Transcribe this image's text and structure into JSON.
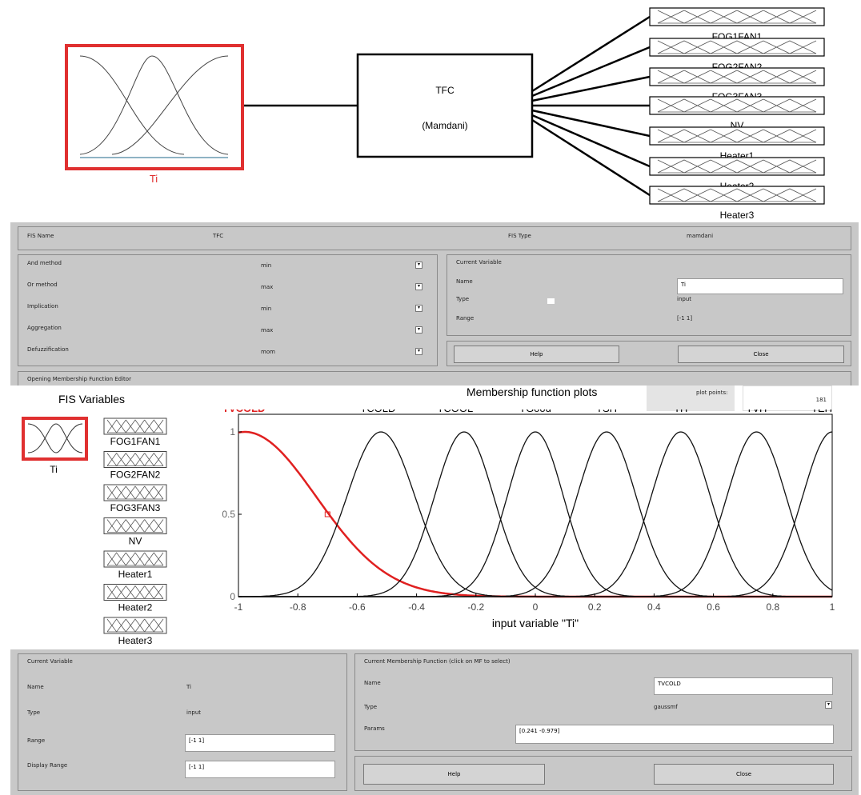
{
  "diagram": {
    "input_name": "Ti",
    "system_name": "TFC",
    "system_type": "(Mamdani)",
    "outputs": [
      "FOG1FAN1",
      "FOG2FAN2",
      "FOG3FAN3",
      "NV",
      "Heater1",
      "Heater2",
      "Heater3"
    ]
  },
  "fis_editor": {
    "fis_name_label": "FIS Name",
    "fis_name_value": "TFC",
    "fis_type_label": "FIS Type",
    "fis_type_value": "mamdani",
    "methods": [
      {
        "label": "And method",
        "value": "min"
      },
      {
        "label": "Or method",
        "value": "max"
      },
      {
        "label": "Implication",
        "value": "min"
      },
      {
        "label": "Aggregation",
        "value": "max"
      },
      {
        "label": "Defuzzification",
        "value": "mom"
      }
    ],
    "current_variable": {
      "title": "Current Variable",
      "name_label": "Name",
      "name_value": "Ti",
      "type_label": "Type",
      "type_value": "input",
      "range_label": "Range",
      "range_value": "[-1 1]"
    },
    "help_label": "Help",
    "close_label": "Close",
    "status": "Opening Membership Function Editor"
  },
  "mf_editor": {
    "fis_variables_title": "FIS Variables",
    "input_var": "Ti",
    "output_vars": [
      "FOG1FAN1",
      "FOG2FAN2",
      "FOG3FAN3",
      "NV",
      "Heater1",
      "Heater2",
      "Heater3"
    ],
    "plot_title": "Membership function plots",
    "plot_points_label": "plot points:",
    "plot_points_value": "181",
    "mf_names": [
      "TVCOLD",
      "TCOLD",
      "TCOOL",
      "TGood",
      "TSH",
      "TH",
      "TVH",
      "TEH"
    ],
    "x_label": "input variable \"Ti\"",
    "x_ticks": [
      "-1",
      "-0.8",
      "-0.6",
      "-0.4",
      "-0.2",
      "0",
      "0.2",
      "0.4",
      "0.6",
      "0.8",
      "1"
    ],
    "y_ticks": [
      "0",
      "0.5",
      "1"
    ],
    "current_variable": {
      "title": "Current Variable",
      "name_label": "Name",
      "name_value": "Ti",
      "type_label": "Type",
      "type_value": "input",
      "range_label": "Range",
      "range_value": "[-1 1]",
      "display_range_label": "Display Range",
      "display_range_value": "[-1 1]"
    },
    "current_mf": {
      "title": "Current Membership Function (click on MF to select)",
      "name_label": "Name",
      "name_value": "TVCOLD",
      "type_label": "Type",
      "type_value": "gaussmf",
      "params_label": "Params",
      "params_value": "[0.241 -0.979]"
    },
    "help_label": "Help",
    "close_label": "Close"
  },
  "chart_data": {
    "type": "line",
    "title": "Membership function plots",
    "xlabel": "input variable \"Ti\"",
    "ylabel": "",
    "xlim": [
      -1,
      1
    ],
    "ylim": [
      0,
      1
    ],
    "series": [
      {
        "name": "TVCOLD",
        "center": -0.979,
        "sigma": 0.241,
        "color": "#e02020"
      },
      {
        "name": "TCOLD",
        "center": -0.52,
        "sigma": 0.115,
        "color": "#111111"
      },
      {
        "name": "TCOOL",
        "center": -0.24,
        "sigma": 0.1,
        "color": "#111111"
      },
      {
        "name": "TGood",
        "center": 0,
        "sigma": 0.095,
        "color": "#111111"
      },
      {
        "name": "TSH",
        "center": 0.24,
        "sigma": 0.1,
        "color": "#111111"
      },
      {
        "name": "TH",
        "center": 0.49,
        "sigma": 0.1,
        "color": "#111111"
      },
      {
        "name": "TVH",
        "center": 0.745,
        "sigma": 0.1,
        "color": "#111111"
      },
      {
        "name": "TEH",
        "center": 1.0,
        "sigma": 0.1,
        "color": "#111111"
      }
    ]
  },
  "colors": {
    "selected": "#e02020",
    "panel": "#c8c8c8"
  }
}
